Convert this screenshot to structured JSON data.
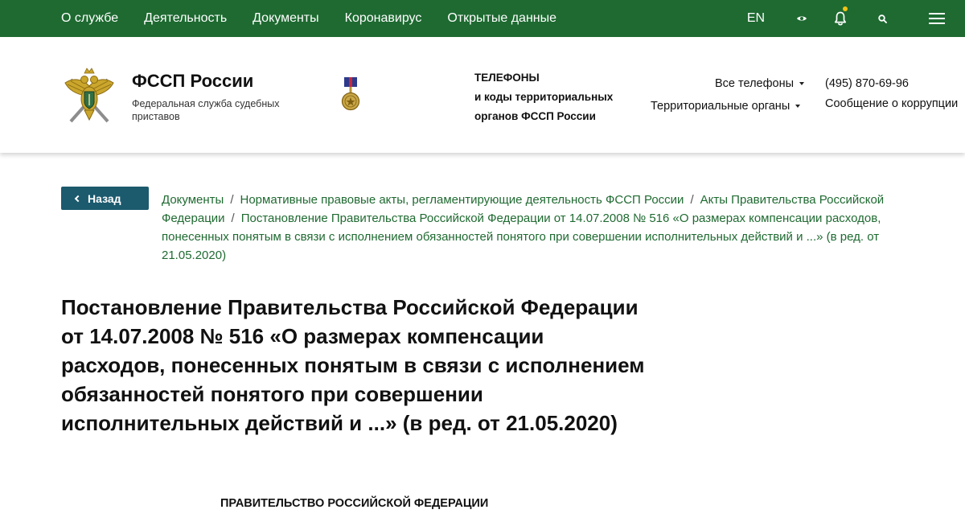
{
  "topbar": {
    "nav": [
      "О службе",
      "Деятельность",
      "Документы",
      "Коронавирус",
      "Открытые данные"
    ],
    "lang": "EN",
    "colors": {
      "background": "#1e6a31",
      "bell_dot": "#f3c316"
    },
    "icons": [
      "eye-icon",
      "bell-icon",
      "search-icon",
      "menu-icon"
    ]
  },
  "header": {
    "brand_title": "ФССП России",
    "brand_subtitle": "Федеральная служба судебных приставов",
    "phones_block": [
      "ТЕЛЕФОНЫ",
      "и коды территориальных",
      "органов ФССП России"
    ],
    "all_phones": "Все телефоны",
    "territorial": "Территориальные органы",
    "phone_number": "(495) 870-69-96",
    "corruption": "Сообщение о коррупции"
  },
  "breadcrumb": {
    "back_label": "Назад",
    "back_color": "#1c5a6e",
    "link_color": "#1f6a31",
    "items": [
      "Документы",
      "Нормативные правовые акты, регламентирующие деятельность ФССП России",
      "Акты Правительства Российской Федерации",
      "Постановление Правительства Российской Федерации от 14.07.2008 № 516 «О размерах компенсации расходов, понесенных понятым в связи с исполнением обязанностей понятого при совершении исполнительных действий и ...» (в ред. от 21.05.2020)"
    ]
  },
  "page": {
    "title": "Постановление Правительства Российской Федерации от 14.07.2008 № 516 «О размерах компенсации расходов, понесенных понятым в связи с исполнением обязанностей понятого при совершении исполнительных действий и ...» (в ред. от 21.05.2020)",
    "doc_heading": "ПРАВИТЕЛЬСТВО РОССИЙСКОЙ ФЕДЕРАЦИИ"
  }
}
